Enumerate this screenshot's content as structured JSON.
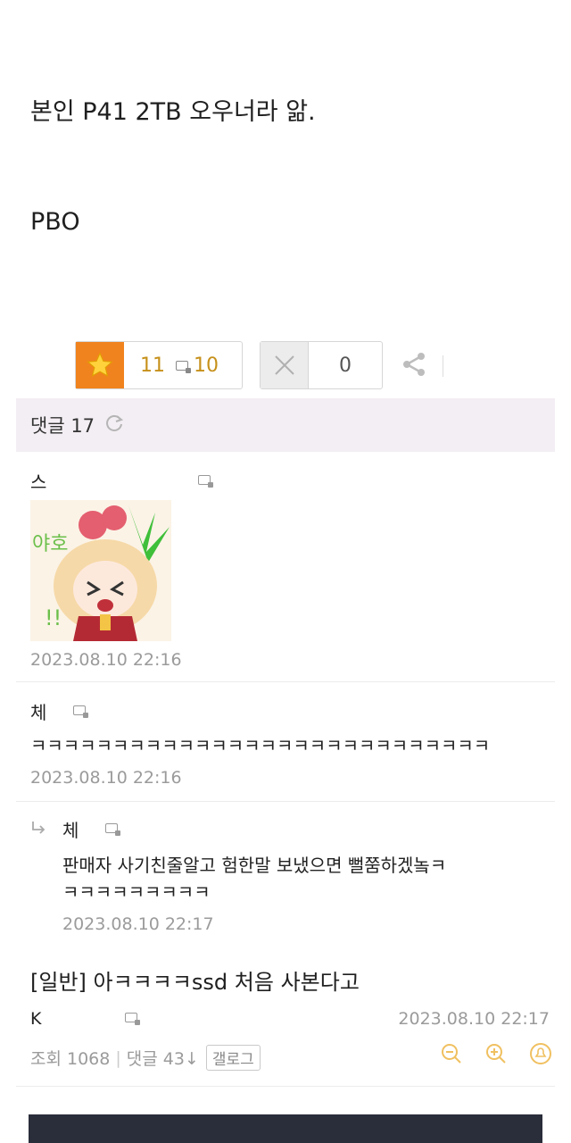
{
  "post": {
    "line1": "본인 P41 2TB 오우너라 앎.",
    "line2": "PBO"
  },
  "votes": {
    "recommend_count": "11",
    "fixed_count": "10",
    "nonrecommend_count": "0"
  },
  "comments_header": {
    "label": "댓글 17"
  },
  "comments": [
    {
      "author": "스",
      "date": "2023.08.10 22:16",
      "sticker_text": "야호"
    },
    {
      "author": "체",
      "text": "ㅋㅋㅋㅋㅋㅋㅋㅋㅋㅋㅋㅋㅋㅋㅋㅋㅋㅋㅋㅋㅋㅋㅋㅋㅋㅋㅋㅋ",
      "date": "2023.08.10 22:16"
    },
    {
      "author": "체",
      "text_line1": "판매자 사기친줄알고 험한말 보냈으면 뻘쭘하겠놐ㅋ",
      "text_line2": "ㅋㅋㅋㅋㅋㅋㅋㅋㅋ",
      "date": "2023.08.10 22:17"
    }
  ],
  "related": {
    "title": "[일반] 아ㅋㅋㅋㅋssd 처음 사본다고",
    "author": "K",
    "date": "2023.08.10 22:17",
    "views": "조회 1068",
    "comments": "댓글 43↓",
    "gallery": "갤로그"
  },
  "colors": {
    "accent_orange": "#f0831e",
    "count_gold": "#c6901a",
    "header_bg": "#f3eef3"
  }
}
